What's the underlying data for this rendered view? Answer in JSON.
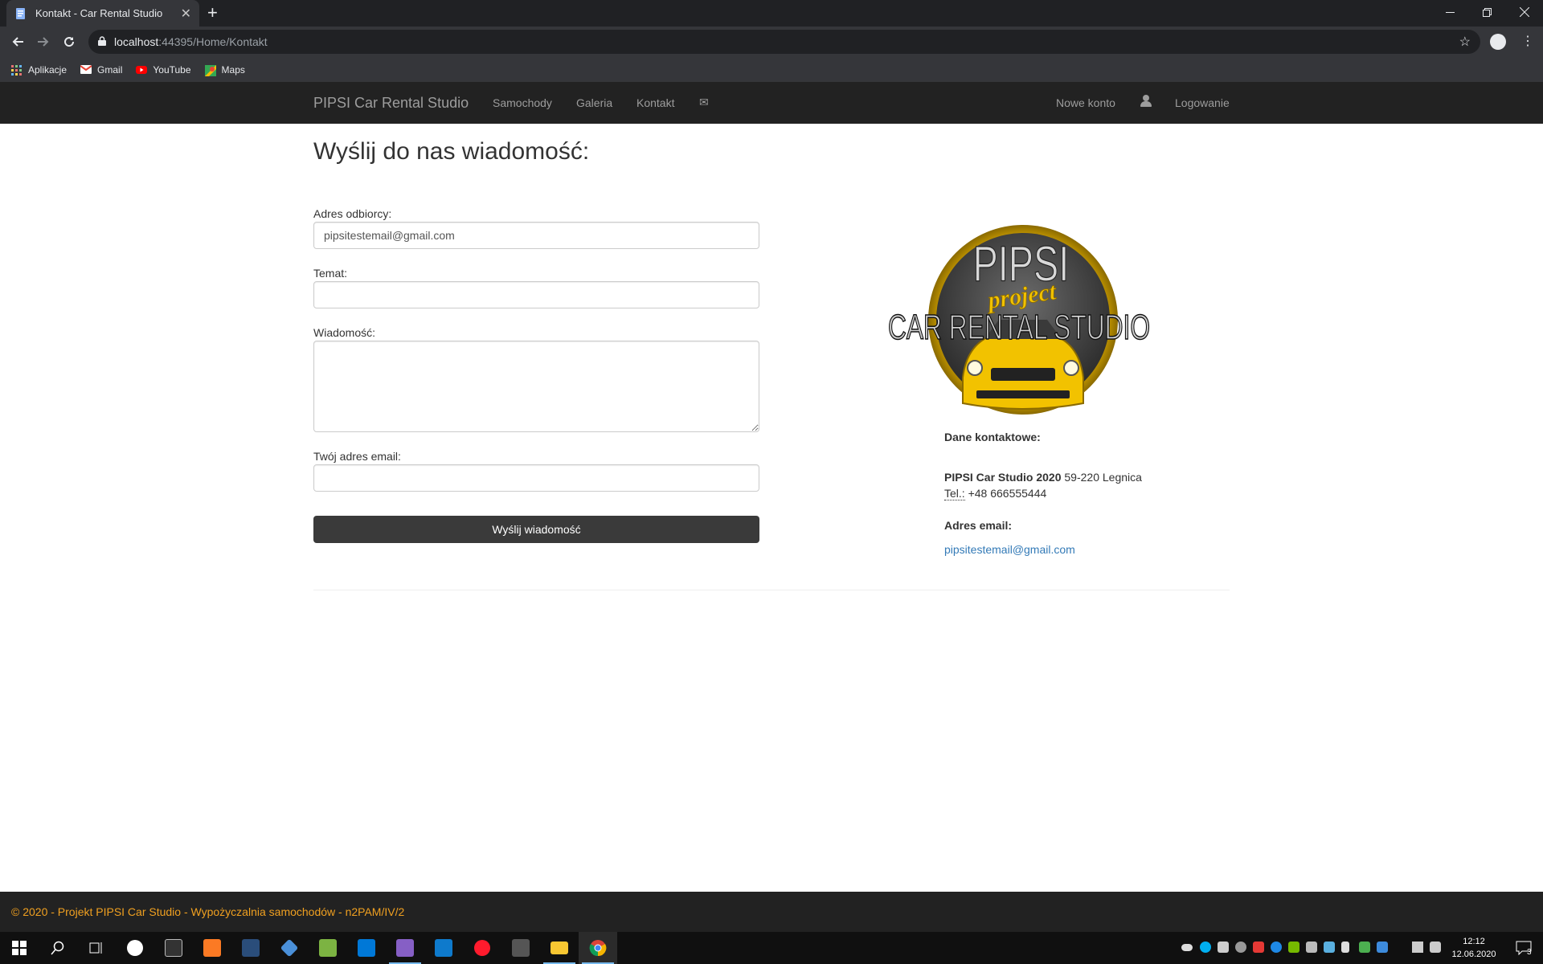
{
  "browser": {
    "tab_title": "Kontakt - Car Rental Studio",
    "tab_close": "✕",
    "new_tab": "+",
    "url_host": "localhost",
    "url_path": ":44395/Home/Kontakt",
    "bookmarks": [
      {
        "label": "Aplikacje",
        "icon": "apps-grid-icon",
        "color": "#e57373"
      },
      {
        "label": "Gmail",
        "icon": "gmail-icon",
        "color": "#ea4335"
      },
      {
        "label": "YouTube",
        "icon": "youtube-icon",
        "color": "#ff0000"
      },
      {
        "label": "Maps",
        "icon": "maps-icon",
        "color": "#34a853"
      }
    ]
  },
  "navbar": {
    "brand": "PIPSI Car Rental Studio",
    "links": [
      "Samochody",
      "Galeria",
      "Kontakt"
    ],
    "mail_icon": "✉",
    "register": "Nowe konto",
    "login": "Logowanie"
  },
  "page": {
    "title": "Wyślij do nas wiadomość:",
    "form": {
      "recipient_label": "Adres odbiorcy:",
      "recipient_value": "pipsitestemail@gmail.com",
      "subject_label": "Temat:",
      "subject_value": "",
      "message_label": "Wiadomość:",
      "message_value": "",
      "sender_label": "Twój adres email:",
      "sender_value": "",
      "submit_label": "Wyślij wiadomość"
    },
    "logo": {
      "line1": "PIPSI",
      "line2": "project",
      "line3": "CAR RENTAL STUDIO"
    },
    "contact": {
      "heading": "Dane kontaktowe:",
      "company": "PIPSI Car Studio 2020",
      "address": " 59-220 Legnica",
      "phone_label": "Tel.:",
      "phone": " +48 666555444",
      "email_heading": "Adres email:",
      "email": "pipsitestemail@gmail.com"
    }
  },
  "footer": {
    "text": "© 2020 - Projekt PIPSI Car Studio - Wypożyczalnia samochodów - n2PAM/IV/2"
  },
  "taskbar": {
    "time": "12:12",
    "date": "12.06.2020",
    "notifications": "3"
  }
}
